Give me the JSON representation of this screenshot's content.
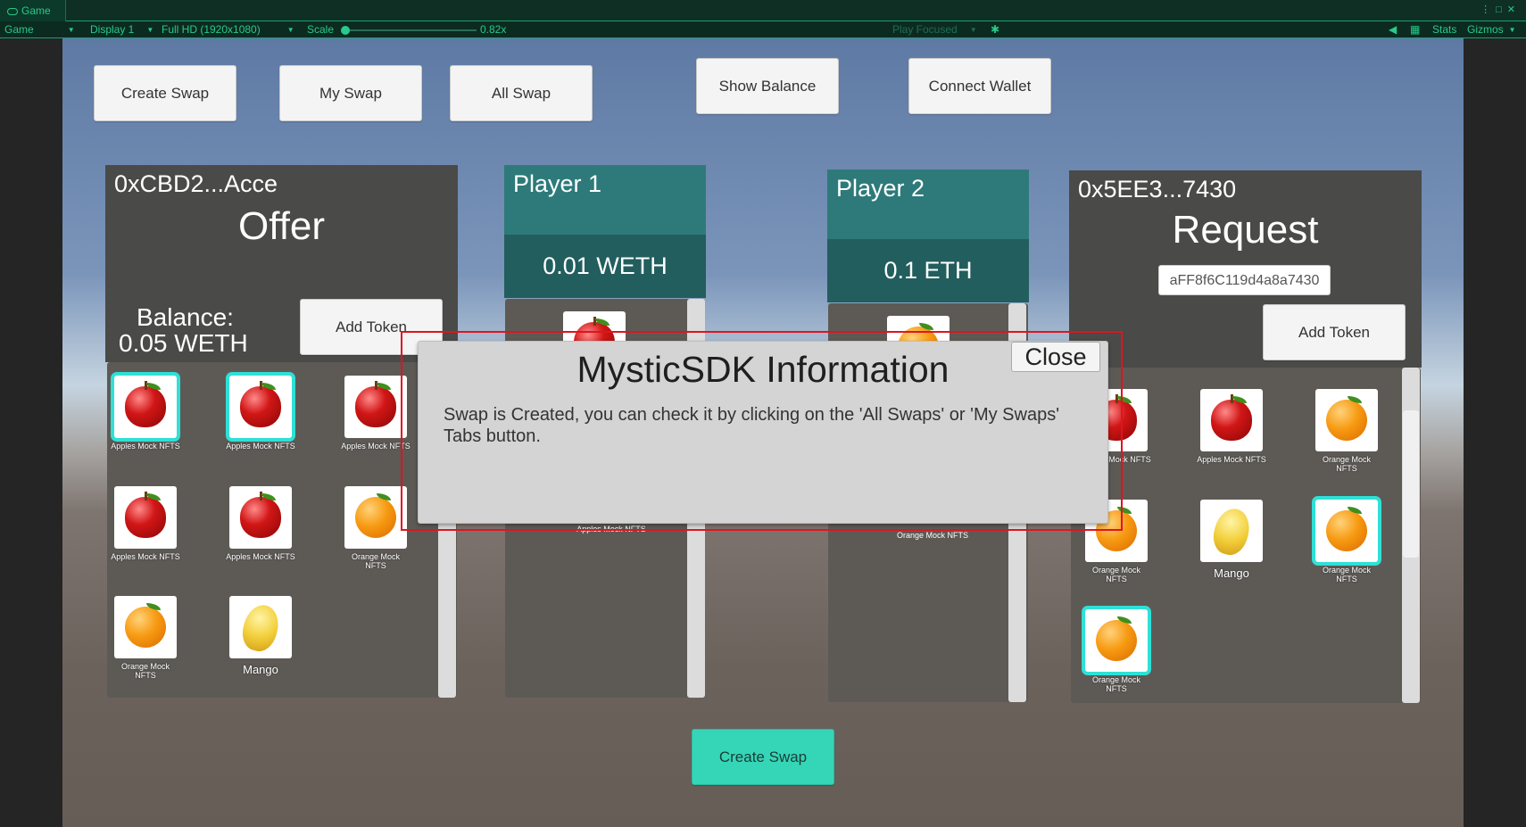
{
  "editor": {
    "tab_label": "Game",
    "toolbar": {
      "view_select": "Game",
      "display_select": "Display 1",
      "resolution_select": "Full HD (1920x1080)",
      "scale_label": "Scale",
      "scale_value": "0.82x",
      "play_focused": "Play Focused",
      "stats": "Stats",
      "gizmos": "Gizmos"
    }
  },
  "top_buttons": {
    "create_swap": "Create Swap",
    "my_swap": "My Swap",
    "all_swap": "All Swap",
    "show_balance": "Show Balance",
    "connect_wallet": "Connect Wallet"
  },
  "offer": {
    "address": "0xCBD2...Acce",
    "title": "Offer",
    "balance_line1": "Balance:",
    "balance_line2": "0.05 WETH",
    "add_token": "Add Token",
    "items": [
      {
        "caption": "Apples Mock NFTS",
        "fruit": "apple",
        "selected": true
      },
      {
        "caption": "Apples Mock NFTS",
        "fruit": "apple",
        "selected": true
      },
      {
        "caption": "Apples Mock NFTS",
        "fruit": "apple",
        "selected": false
      },
      {
        "caption": "Apples Mock NFTS",
        "fruit": "apple",
        "selected": false
      },
      {
        "caption": "Apples Mock NFTS",
        "fruit": "apple",
        "selected": false
      },
      {
        "caption": "Orange Mock NFTS",
        "fruit": "orange",
        "selected": false
      },
      {
        "caption": "Orange Mock NFTS",
        "fruit": "orange",
        "selected": false
      },
      {
        "caption": "Mango",
        "fruit": "mango",
        "selected": false
      }
    ]
  },
  "player1": {
    "name": "Player 1",
    "amount": "0.01 WETH",
    "partial_caption": "Apples Mock NFTS"
  },
  "player2": {
    "name": "Player 2",
    "amount": "0.1 ETH",
    "partial_caption": "Orange Mock NFTS"
  },
  "request": {
    "address": "0x5EE3...7430",
    "title": "Request",
    "address_input_value": "aFF8f6C119d4a8a7430",
    "add_token": "Add Token",
    "items": [
      {
        "caption": "Apples Mock NFTS",
        "fruit": "apple",
        "selected": false
      },
      {
        "caption": "Apples Mock NFTS",
        "fruit": "apple",
        "selected": false
      },
      {
        "caption": "Orange Mock NFTS",
        "fruit": "orange",
        "selected": false
      },
      {
        "caption": "Orange Mock NFTS",
        "fruit": "orange",
        "selected": false
      },
      {
        "caption": "Mango",
        "fruit": "mango",
        "selected": false
      },
      {
        "caption": "Orange Mock NFTS",
        "fruit": "orange",
        "selected": true
      },
      {
        "caption": "Orange Mock NFTS",
        "fruit": "orange",
        "selected": true
      }
    ]
  },
  "bottom_create_swap": "Create Swap",
  "modal": {
    "title": "MysticSDK Information",
    "close": "Close",
    "message": "Swap is Created, you can check it by clicking on the 'All Swaps' or 'My Swaps' Tabs button."
  },
  "colors": {
    "accent_teal": "#35d6b8",
    "selection_cyan": "#2fe0d6",
    "player_header": "#2e7a7a",
    "highlight_red": "#e0141e"
  }
}
